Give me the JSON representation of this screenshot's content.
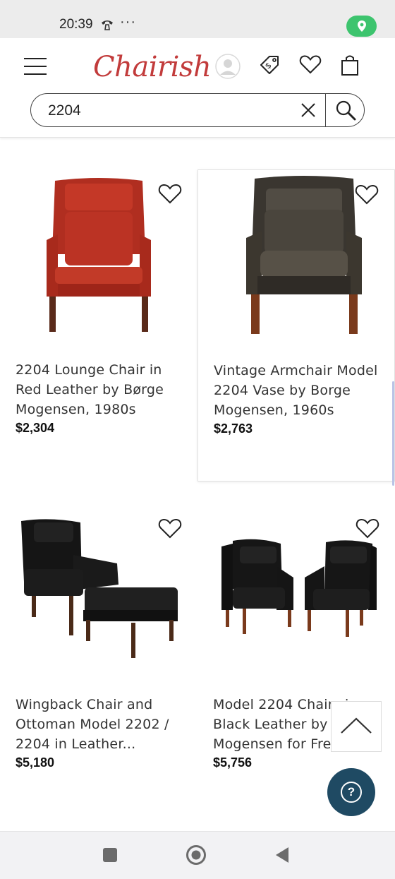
{
  "status_bar": {
    "time": "20:39",
    "dots": "···",
    "icons": [
      "call-icon",
      "location-icon"
    ]
  },
  "header": {
    "logo": "Chairish",
    "icons": [
      "menu-icon",
      "user-icon",
      "price-tag-icon",
      "heart-icon",
      "shopping-bag-icon"
    ]
  },
  "search": {
    "value": "2204",
    "icons": [
      "close-icon",
      "search-icon"
    ]
  },
  "products": [
    {
      "title": "2204 Lounge Chair in Red Leather by Børge Mogensen, 1980s",
      "price": "$2,304"
    },
    {
      "title": "Vintage Armchair Model 2204 Vase by Borge Mogensen, 1960s",
      "price": "$2,763"
    },
    {
      "title": "Wingback Chair and Ottoman Model 2202 / 2204 in Leather...",
      "price": "$5,180"
    },
    {
      "title": "Model 2204 Chairs in Black Leather by Børge Mogensen for Fredericia",
      "price": "$5,756"
    }
  ],
  "colors": {
    "brand": "#c23b3b",
    "help_button": "#1f4a63",
    "location_pill": "#3dc46e"
  },
  "floating": {
    "scroll_top_icon": "chevron-up-icon",
    "help_label": "?"
  },
  "nav_bar": {
    "icons": [
      "recents-square-icon",
      "home-circle-icon",
      "back-triangle-icon"
    ]
  }
}
